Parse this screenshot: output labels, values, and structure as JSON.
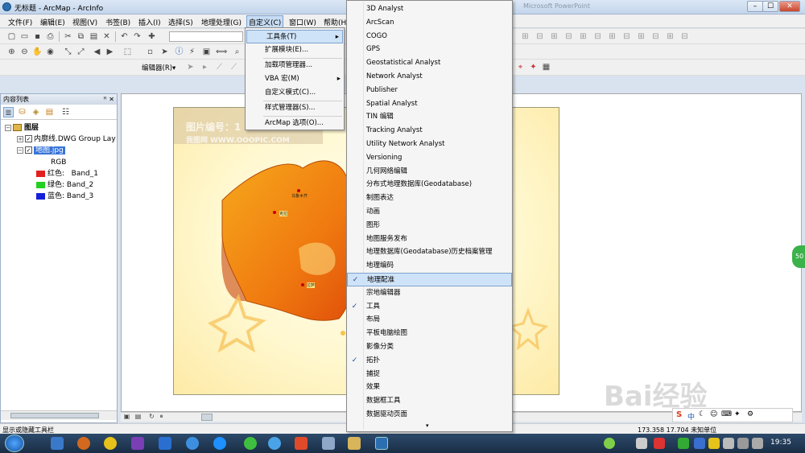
{
  "window": {
    "title": "无标题 - ArcMap - ArcInfo",
    "bg_title": "Microsoft PowerPoint"
  },
  "menubar": {
    "items": [
      "文件(F)",
      "编辑(E)",
      "视图(V)",
      "书签(B)",
      "插入(I)",
      "选择(S)",
      "地理处理(G)",
      "自定义(C)",
      "窗口(W)",
      "帮助(H)"
    ]
  },
  "editor": {
    "label": "编辑器(R)▾"
  },
  "toc": {
    "title": "内容列表",
    "pin": "ꟸ ✕",
    "root": "图层",
    "layer1": "内廓线.DWG Group Lay",
    "layer2": "地图.jpg",
    "rgb": "RGB",
    "bands": [
      {
        "label": "红色:",
        "band": "Band_1",
        "color": "#e32020"
      },
      {
        "label": "绿色:",
        "band": "Band_2",
        "color": "#22d022"
      },
      {
        "label": "蓝色:",
        "band": "Band_3",
        "color": "#1420d8"
      }
    ]
  },
  "customize_menu": {
    "items": [
      "工具条(T)",
      "扩展模块(E)...",
      "加载项管理器...",
      "VBA 宏(M)",
      "自定义模式(C)...",
      "样式管理器(S)...",
      "ArcMap 选项(O)..."
    ]
  },
  "toolbars_submenu": {
    "items": [
      {
        "label": "3D Analyst",
        "checked": false
      },
      {
        "label": "ArcScan",
        "checked": false
      },
      {
        "label": "COGO",
        "checked": false
      },
      {
        "label": "GPS",
        "checked": false
      },
      {
        "label": "Geostatistical Analyst",
        "checked": false
      },
      {
        "label": "Network Analyst",
        "checked": false
      },
      {
        "label": "Publisher",
        "checked": false
      },
      {
        "label": "Spatial Analyst",
        "checked": false
      },
      {
        "label": "TIN 编辑",
        "checked": false
      },
      {
        "label": "Tracking Analyst",
        "checked": false
      },
      {
        "label": "Utility Network Analyst",
        "checked": false
      },
      {
        "label": "Versioning",
        "checked": false
      },
      {
        "label": "几何网络编辑",
        "checked": false
      },
      {
        "label": "分布式地理数据库(Geodatabase)",
        "checked": false
      },
      {
        "label": "制图表达",
        "checked": false
      },
      {
        "label": "动画",
        "checked": false
      },
      {
        "label": "图形",
        "checked": false
      },
      {
        "label": "地图服务发布",
        "checked": false
      },
      {
        "label": "地理数据库(Geodatabase)历史档案管理",
        "checked": false
      },
      {
        "label": "地理编码",
        "checked": false
      },
      {
        "label": "地理配准",
        "checked": true,
        "highlighted": true
      },
      {
        "label": "宗地编辑器",
        "checked": false
      },
      {
        "label": "工具",
        "checked": true
      },
      {
        "label": "布局",
        "checked": false
      },
      {
        "label": "平板电脑绘图",
        "checked": false
      },
      {
        "label": "影像分类",
        "checked": false
      },
      {
        "label": "拓扑",
        "checked": true
      },
      {
        "label": "捕捉",
        "checked": false
      },
      {
        "label": "效果",
        "checked": false
      },
      {
        "label": "数据框工具",
        "checked": false
      },
      {
        "label": "数据驱动页面",
        "checked": false
      }
    ],
    "more_arrow": "▾"
  },
  "map": {
    "watermark_line1": "图片编号：1",
    "watermark_line2": "我图网 WWW.OOOPIC.COM",
    "city_labels": [
      "乌鲁木齐",
      "克拉",
      "拉萨"
    ]
  },
  "statusbar": {
    "left": "显示或隐藏工具栏",
    "coords": "173.358  17.704 未知单位"
  },
  "taskbar": {
    "time": "19:35"
  },
  "baidu": {
    "text": "Bai经验",
    "url": "jingyan.baidu.com"
  },
  "side_badge": "50"
}
